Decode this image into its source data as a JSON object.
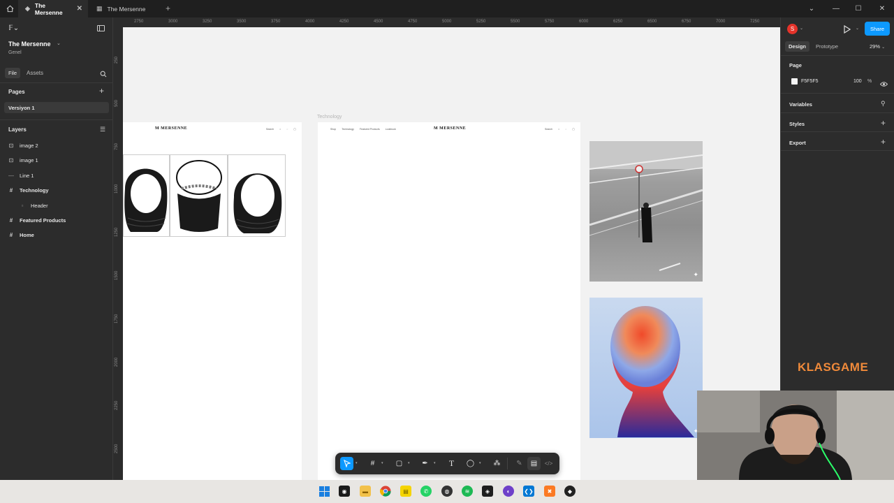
{
  "tabs": [
    {
      "label": "The Mersenne",
      "active": true
    },
    {
      "label": "The Mersenne",
      "active": false
    }
  ],
  "left_panel": {
    "file_name": "The Mersenne",
    "project": "Genel",
    "tab_file": "File",
    "tab_assets": "Assets",
    "pages_title": "Pages",
    "pages": [
      "Versiyon 1"
    ],
    "layers_title": "Layers",
    "layers": [
      {
        "label": "image 2",
        "icon": "image-icon",
        "bold": false,
        "indent": false
      },
      {
        "label": "image 1",
        "icon": "image-icon",
        "bold": false,
        "indent": false
      },
      {
        "label": "Line 1",
        "icon": "line-icon",
        "bold": false,
        "indent": false
      },
      {
        "label": "Technology",
        "icon": "frame-icon",
        "bold": true,
        "indent": false
      },
      {
        "label": "Header",
        "icon": "rectangle-icon",
        "bold": false,
        "indent": true
      },
      {
        "label": "Featured Products",
        "icon": "frame-icon",
        "bold": true,
        "indent": false
      },
      {
        "label": "Home",
        "icon": "frame-icon",
        "bold": true,
        "indent": false
      }
    ]
  },
  "ruler": {
    "top": [
      "2750",
      "3000",
      "3250",
      "3500",
      "3750",
      "4000",
      "4250",
      "4500",
      "4750",
      "5000",
      "5250",
      "5500",
      "5750",
      "6000",
      "6250",
      "6500",
      "6750",
      "7000",
      "7250"
    ],
    "left": [
      "250",
      "500",
      "750",
      "1000",
      "1250",
      "1500",
      "1750",
      "2000",
      "2250",
      "2500"
    ]
  },
  "canvas": {
    "frame_label": "Technology",
    "brand": "MERSENNE",
    "nav_left": [
      "Shop",
      "Technology",
      "Featured Products",
      "Lookbook"
    ],
    "nav_right_label": "Search"
  },
  "right_panel": {
    "avatar": "S",
    "share": "Share",
    "tab_design": "Design",
    "tab_prototype": "Prototype",
    "zoom": "29%",
    "page_title": "Page",
    "page_color_hex": "F5F5F5",
    "page_opacity": "100",
    "percent": "%",
    "variables": "Variables",
    "styles": "Styles",
    "export": "Export"
  },
  "watermark": "KLASGAME",
  "colors": {
    "accent": "#0d99ff",
    "panel": "#2c2c2c",
    "canvas": "#f2f2f2",
    "avatar": "#e5332a"
  }
}
